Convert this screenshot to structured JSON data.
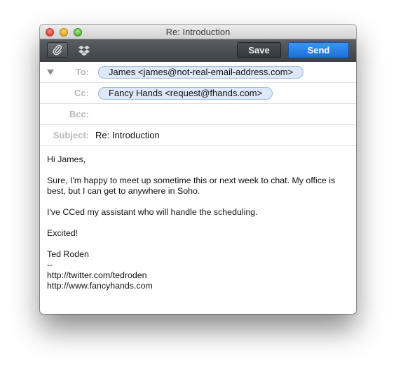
{
  "window": {
    "title": "Re: Introduction"
  },
  "toolbar": {
    "attach_icon": "paperclip-icon",
    "dropbox_icon": "dropbox-icon",
    "save_label": "Save",
    "send_label": "Send"
  },
  "fields": {
    "to_label": "To:",
    "to_value": "James <james@not-real-email-address.com>",
    "cc_label": "Cc:",
    "cc_value": "Fancy Hands <request@fhands.com>",
    "bcc_label": "Bcc:",
    "subject_label": "Subject:",
    "subject_value": "Re: Introduction"
  },
  "body": {
    "greeting": "Hi James,",
    "paragraph1": "Sure, I'm happy to meet up sometime this or next week to chat. My office is best, but I can get to anywhere in Soho.",
    "paragraph2": "I've CCed my assistant who will handle the scheduling.",
    "paragraph3": "Excited!",
    "signature_name": "Ted Roden",
    "signature_sep": "--",
    "signature_link1": "http://twitter.com/tedroden",
    "signature_link2": "http://www.fancyhands.com"
  },
  "colors": {
    "send_button": "#1d6fd6",
    "token_fill": "#dde8f8",
    "token_border": "#9db6dc"
  }
}
